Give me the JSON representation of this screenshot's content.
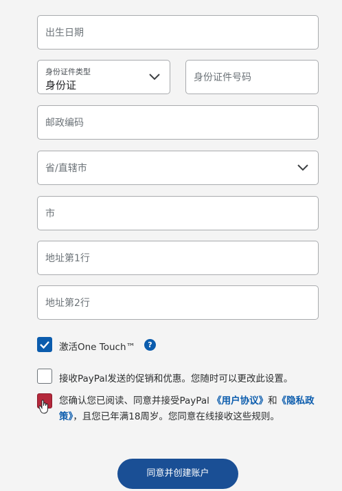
{
  "form": {
    "dob": {
      "placeholder": "出生日期"
    },
    "id_type": {
      "label": "身份证件类型",
      "value": "身份证"
    },
    "id_number": {
      "placeholder": "身份证件号码"
    },
    "postal": {
      "placeholder": "邮政编码"
    },
    "province": {
      "placeholder": "省/直辖市"
    },
    "city": {
      "placeholder": "市"
    },
    "address1": {
      "placeholder": "地址第1行"
    },
    "address2": {
      "placeholder": "地址第2行"
    }
  },
  "options": {
    "one_touch": {
      "label": "激活One Touch™",
      "checked": true,
      "help_icon": "?"
    },
    "promo": {
      "label": "接收PayPal发送的促销和优惠。您随时可以更改此设置。",
      "checked": false
    },
    "agreement": {
      "text_before": "您确认您已阅读、同意并接受PayPal ",
      "link_user_agreement": "《用户协议》",
      "text_and": "和",
      "link_privacy": "《隐私政策》",
      "text_after": "，且您已年满18周岁。您同意在线接收这些规则。",
      "checked": true
    }
  },
  "submit": {
    "label": "同意并创建账户"
  },
  "colors": {
    "accent": "#0b5cad",
    "button": "#1a4f95",
    "border": "#a8aaad"
  }
}
